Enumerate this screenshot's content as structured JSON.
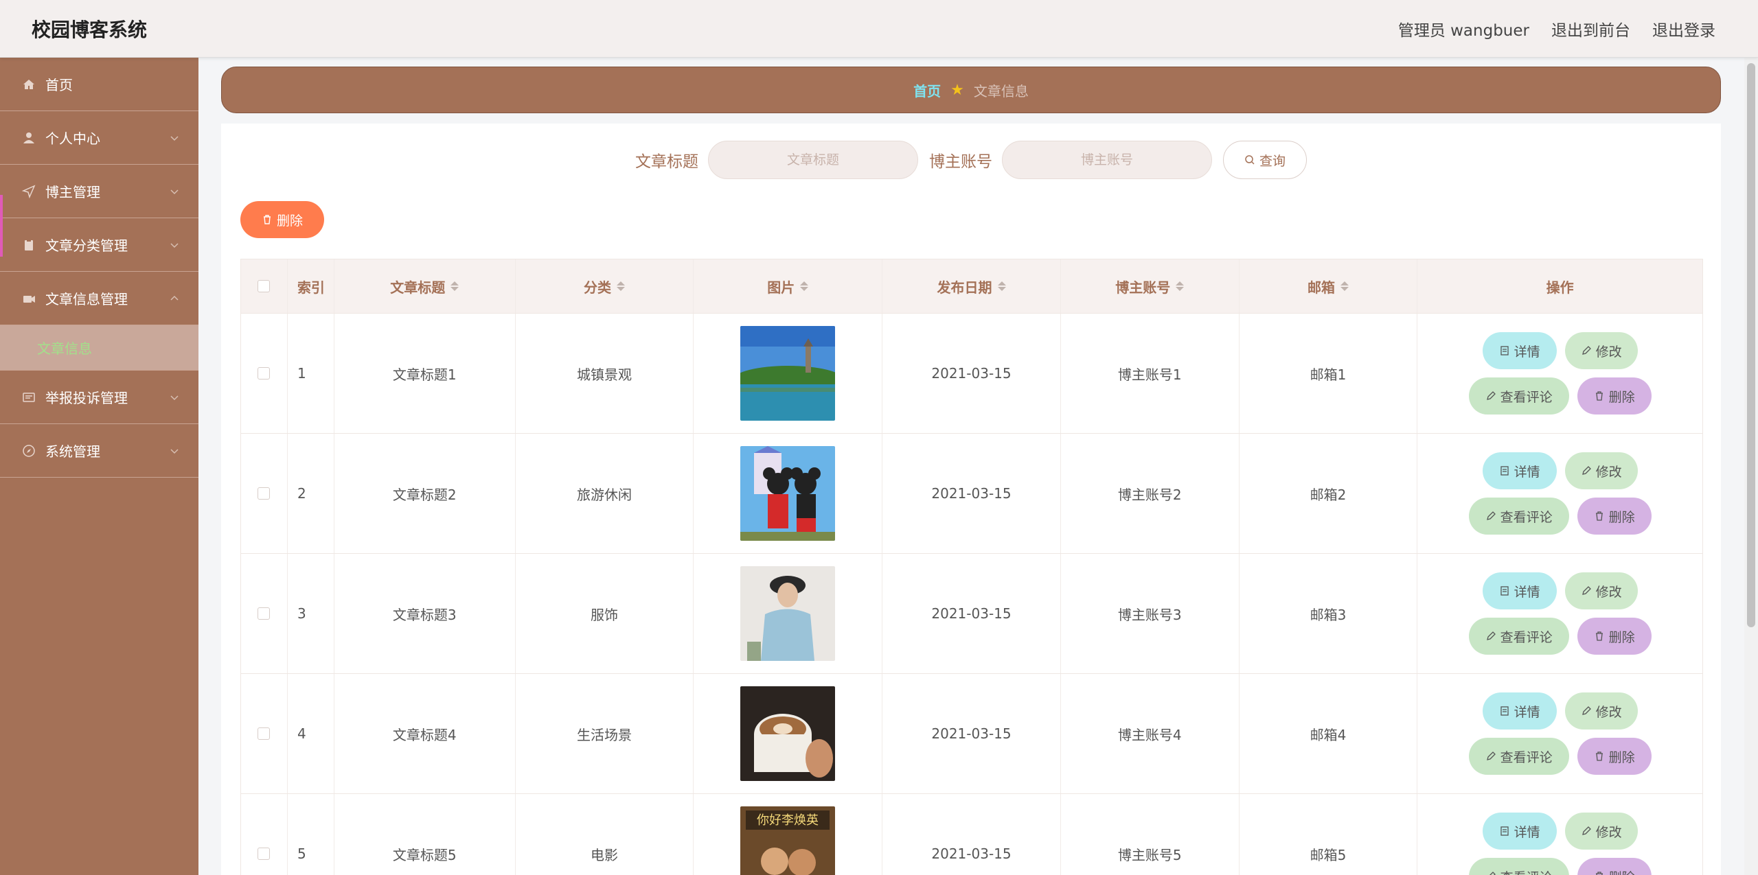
{
  "header": {
    "title": "校园博客系统",
    "admin": "管理员 wangbuer",
    "to_front": "退出到前台",
    "logout": "退出登录"
  },
  "sidebar": {
    "items": [
      {
        "label": "首页",
        "icon": "home-icon",
        "expandable": false
      },
      {
        "label": "个人中心",
        "icon": "user-icon",
        "expandable": true
      },
      {
        "label": "博主管理",
        "icon": "send-icon",
        "expandable": true
      },
      {
        "label": "文章分类管理",
        "icon": "clipboard-icon",
        "expandable": true
      },
      {
        "label": "文章信息管理",
        "icon": "video-icon",
        "expandable": true,
        "expanded": true
      },
      {
        "label": "举报投诉管理",
        "icon": "message-icon",
        "expandable": true
      },
      {
        "label": "系统管理",
        "icon": "compass-icon",
        "expandable": true
      }
    ],
    "submenu_active": "文章信息"
  },
  "breadcrumb": {
    "home": "首页",
    "current": "文章信息"
  },
  "search": {
    "title_label": "文章标题",
    "title_placeholder": "文章标题",
    "account_label": "博主账号",
    "account_placeholder": "博主账号",
    "query_button": "查询"
  },
  "toolbar": {
    "delete_button": "删除"
  },
  "table": {
    "headers": [
      "索引",
      "文章标题",
      "分类",
      "图片",
      "发布日期",
      "博主账号",
      "邮箱",
      "操作"
    ],
    "rows": [
      {
        "index": "1",
        "title": "文章标题1",
        "category": "城镇景观",
        "image": "lake-pagoda",
        "date": "2021-03-15",
        "account": "博主账号1",
        "email": "邮箱1"
      },
      {
        "index": "2",
        "title": "文章标题2",
        "category": "旅游休闲",
        "image": "mickey-minnie",
        "date": "2021-03-15",
        "account": "博主账号2",
        "email": "邮箱2"
      },
      {
        "index": "3",
        "title": "文章标题3",
        "category": "服饰",
        "image": "woman-hoodie",
        "date": "2021-03-15",
        "account": "博主账号3",
        "email": "邮箱3"
      },
      {
        "index": "4",
        "title": "文章标题4",
        "category": "生活场景",
        "image": "coffee-cup",
        "date": "2021-03-15",
        "account": "博主账号4",
        "email": "邮箱4"
      },
      {
        "index": "5",
        "title": "文章标题5",
        "category": "电影",
        "image": "movie-poster",
        "date": "2021-03-15",
        "account": "博主账号5",
        "email": "邮箱5"
      }
    ],
    "ops": {
      "detail": "详情",
      "edit": "修改",
      "comment": "查看评论",
      "delete": "删除"
    }
  },
  "colors": {
    "sidebar": "#a47157",
    "accent_orange": "#ff7c4d",
    "breadcrumb_home": "#7fe3f0",
    "submenu_text": "#a3e08b"
  }
}
